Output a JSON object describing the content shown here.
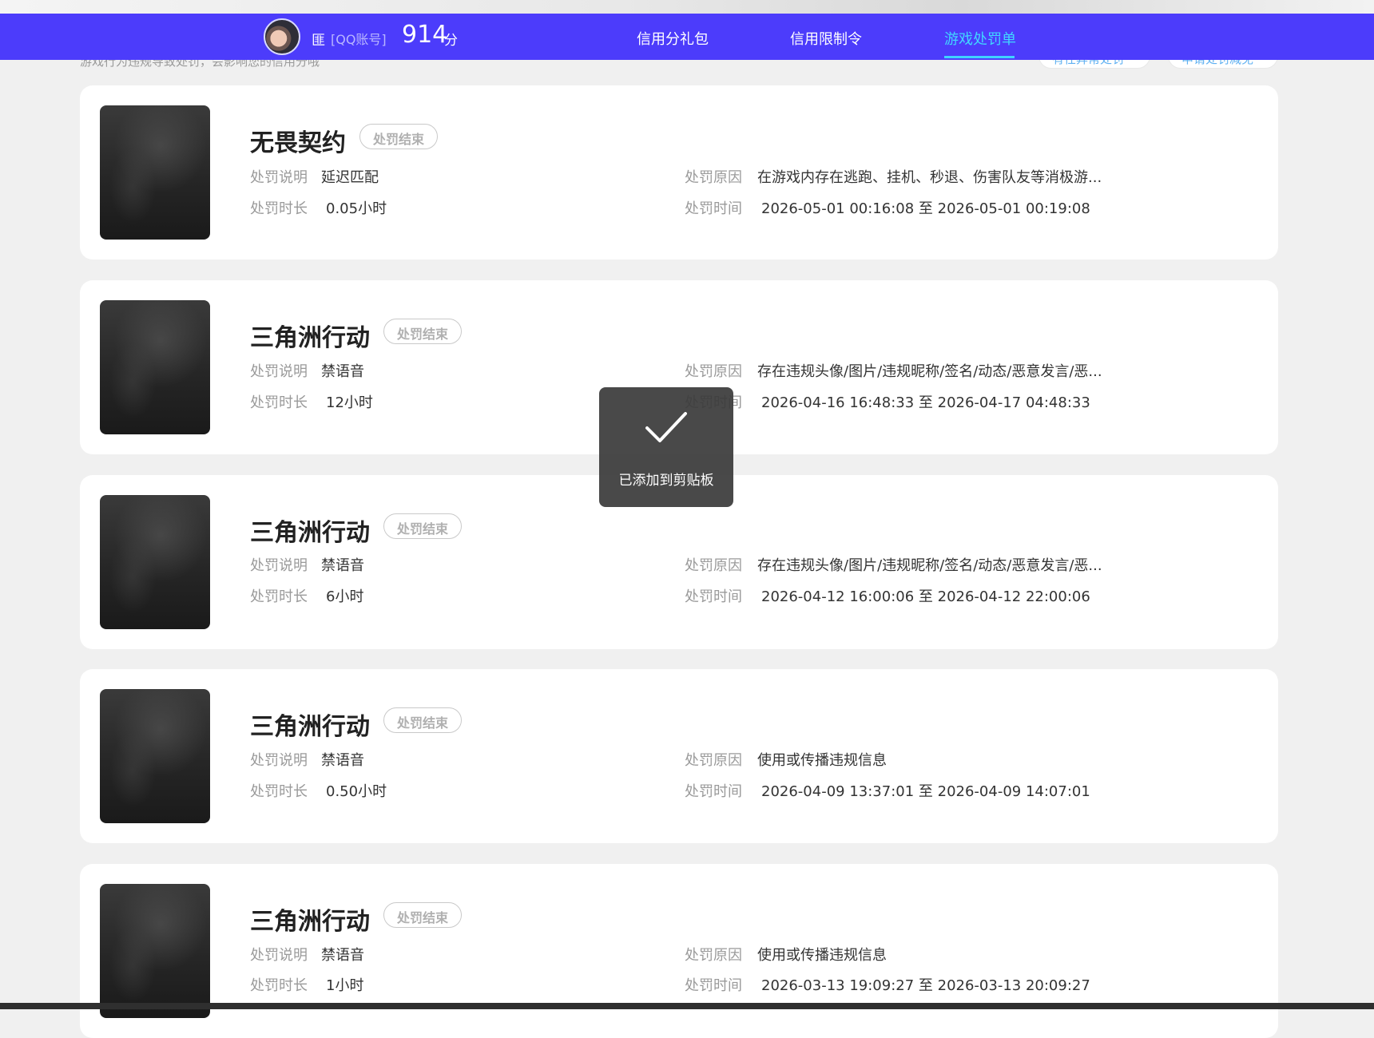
{
  "header": {
    "user_name": "匪",
    "account_type": "[QQ账号]",
    "score": "914",
    "score_unit": "分",
    "tabs": [
      {
        "label": "信用分礼包"
      },
      {
        "label": "信用限制令"
      },
      {
        "label": "游戏处罚单",
        "active": true
      }
    ],
    "bg_color": "#4c3cfb",
    "active_color": "#41d7ff"
  },
  "underlying": {
    "text": "游戏行为违规导致处罚，会影响您的信用分哦",
    "button_1": "有任异常处罚",
    "button_2": "申请处罚减免"
  },
  "labels": {
    "desc": "处罚说明",
    "duration": "处罚时长",
    "reason": "处罚原因",
    "time": "处罚时间"
  },
  "records": [
    {
      "game": "无畏契约",
      "status": "处罚结束",
      "desc": "延迟匹配",
      "duration": "0.05小时",
      "reason": "在游戏内存在逃跑、挂机、秒退、伤害队友等消极游...",
      "time": "2026-05-01 00:16:08 至 2026-05-01 00:19:08"
    },
    {
      "game": "三角洲行动",
      "status": "处罚结束",
      "desc": "禁语音",
      "duration": "12小时",
      "reason": "存在违规头像/图片/违规昵称/签名/动态/恶意发言/恶...",
      "time": "2026-04-16 16:48:33 至 2026-04-17 04:48:33"
    },
    {
      "game": "三角洲行动",
      "status": "处罚结束",
      "desc": "禁语音",
      "duration": "6小时",
      "reason": "存在违规头像/图片/违规昵称/签名/动态/恶意发言/恶...",
      "time": "2026-04-12 16:00:06 至 2026-04-12 22:00:06"
    },
    {
      "game": "三角洲行动",
      "status": "处罚结束",
      "desc": "禁语音",
      "duration": "0.50小时",
      "reason": "使用或传播违规信息",
      "time": "2026-04-09 13:37:01 至 2026-04-09 14:07:01"
    },
    {
      "game": "三角洲行动",
      "status": "处罚结束",
      "desc": "禁语音",
      "duration": "1小时",
      "reason": "使用或传播违规信息",
      "time": "2026-03-13 19:09:27 至 2026-03-13 20:09:27"
    }
  ],
  "toast": {
    "icon": "check-icon",
    "message": "已添加到剪贴板"
  }
}
